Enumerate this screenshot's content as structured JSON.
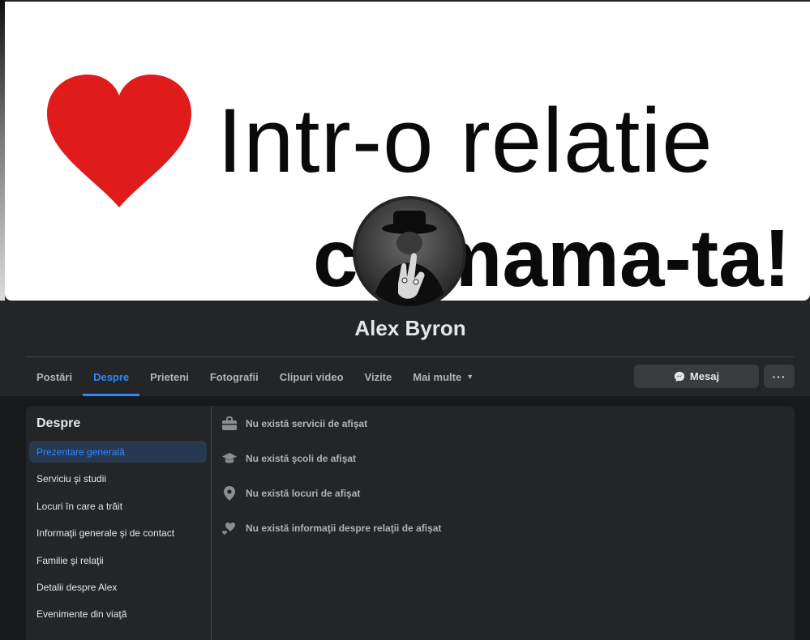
{
  "cover": {
    "line1": "Intr-o relatie",
    "line2": "cu mama-ta!"
  },
  "profile": {
    "name": "Alex Byron"
  },
  "tabs": [
    {
      "label": "Postări"
    },
    {
      "label": "Despre"
    },
    {
      "label": "Prieteni"
    },
    {
      "label": "Fotografii"
    },
    {
      "label": "Clipuri video"
    },
    {
      "label": "Vizite"
    },
    {
      "label": "Mai multe"
    }
  ],
  "actions": {
    "message_label": "Mesaj",
    "more_label": "···"
  },
  "about": {
    "title": "Despre",
    "items": [
      {
        "label": "Prezentare generală"
      },
      {
        "label": "Serviciu şi studii"
      },
      {
        "label": "Locuri în care a trăit"
      },
      {
        "label": "Informaţii generale şi de contact"
      },
      {
        "label": "Familie şi relaţii"
      },
      {
        "label": "Detalii despre Alex"
      },
      {
        "label": "Evenimente din viaţă"
      }
    ],
    "overview": [
      {
        "icon": "briefcase-icon",
        "text": "Nu există servicii de afişat"
      },
      {
        "icon": "graduation-cap-icon",
        "text": "Nu există şcoli de afişat"
      },
      {
        "icon": "location-pin-icon",
        "text": "Nu există locuri de afişat"
      },
      {
        "icon": "hearts-icon",
        "text": "Nu există informaţii despre relaţii de afişat"
      }
    ]
  },
  "colors": {
    "accent": "#2d88ff",
    "background": "#18191a",
    "card": "#242526",
    "heart": "#e01b1b"
  }
}
